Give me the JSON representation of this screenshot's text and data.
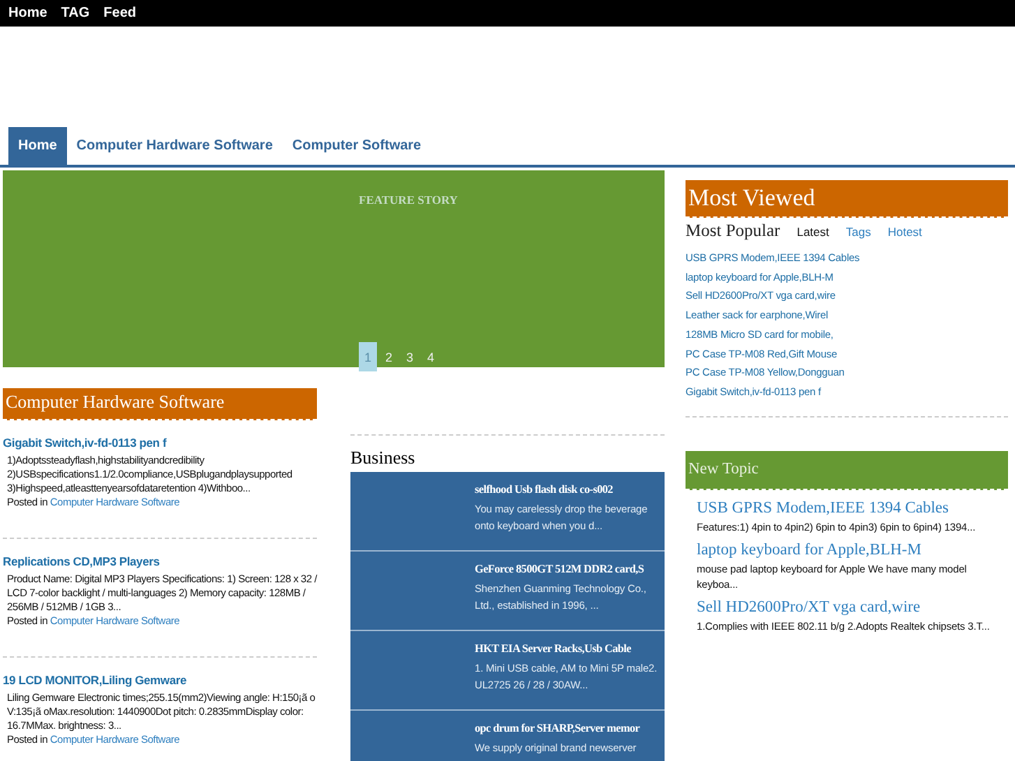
{
  "top_nav": [
    "Home",
    "TAG",
    "Feed"
  ],
  "main_nav": [
    {
      "label": "Home",
      "selected": true
    },
    {
      "label": "Computer Hardware Software",
      "selected": false
    },
    {
      "label": "Computer Software",
      "selected": false
    }
  ],
  "feature": {
    "label": "FEATURE STORY",
    "pages": [
      {
        "label": "1",
        "selected": true
      },
      {
        "label": "2",
        "selected": false
      },
      {
        "label": "3",
        "selected": false
      },
      {
        "label": "4",
        "selected": false
      }
    ]
  },
  "category": {
    "title": "Computer Hardware Software",
    "posts": [
      {
        "title": "Gigabit Switch,iv-fd-0113 pen f",
        "excerpt": "1)Adoptssteadyflash,highstabilityandcredibility 2)USBspecifications1.1/2.0compliance,USBplugandplaysupported 3)Highspeed,atleasttenyearsofdataretention 4)Withboo...",
        "posted": "Posted in",
        "category": "Computer Hardware Software"
      },
      {
        "title": "Replications CD,MP3 Players",
        "excerpt": "Product Name: Digital MP3 Players Specifications: 1) Screen: 128 x 32 / LCD 7-color backlight / multi-languages 2) Memory capacity: 128MB / 256MB / 512MB / 1GB 3...",
        "posted": "Posted in",
        "category": "Computer Hardware Software"
      },
      {
        "title": "19  LCD MONITOR,Liling Gemware",
        "excerpt": "Liling Gemware Electronic times;255.15(mm2)Viewing angle: H:150¡ã o V:135¡ã oMax.resolution: 1440900Dot pitch: 0.2835mmDisplay color: 16.7MMax. brightness: 3...",
        "posted": "Posted in",
        "category": "Computer Hardware Software"
      }
    ]
  },
  "business": {
    "title": "Business",
    "items": [
      {
        "title": "selfhood Usb flash disk co-s002",
        "excerpt": "You may carelessly drop the beverage onto keyboard when you d..."
      },
      {
        "title": "GeForce 8500GT 512M DDR2 card,S",
        "excerpt": "Shenzhen Guanming Technology Co., Ltd., established in 1996, ..."
      },
      {
        "title": "HKT EIA Server Racks,Usb Cable",
        "excerpt": "1. Mini USB cable, AM to Mini 5P male2. UL2725 26 / 28 / 30AW..."
      },
      {
        "title": "opc drum for SHARP,Server memor",
        "excerpt": "We supply original brand newserver"
      }
    ]
  },
  "most_viewed": {
    "title": "Most Viewed",
    "heading": "Most Popular",
    "tabs": [
      {
        "label": "Latest",
        "selected": true
      },
      {
        "label": "Tags",
        "selected": false
      },
      {
        "label": "Hotest",
        "selected": false
      }
    ],
    "links": [
      "USB GPRS Modem,IEEE 1394 Cables",
      "laptop keyboard for Apple,BLH-M",
      "Sell HD2600Pro/XT vga card,wire",
      "Leather sack for earphone,Wirel",
      "128MB Micro SD card for mobile,",
      "PC Case TP-M08 Red,Gift Mouse",
      "PC Case TP-M08 Yellow,Dongguan",
      "Gigabit Switch,iv-fd-0113 pen f"
    ]
  },
  "new_topic": {
    "title": "New Topic",
    "items": [
      {
        "title": "USB GPRS Modem,IEEE 1394 Cables",
        "excerpt": "Features:1) 4pin to 4pin2) 6pin to 4pin3) 6pin to 6pin4) 1394..."
      },
      {
        "title": "laptop keyboard for Apple,BLH-M",
        "excerpt": "mouse pad laptop keyboard for Apple We have many model keyboa..."
      },
      {
        "title": "Sell HD2600Pro/XT vga card,wire",
        "excerpt": "1.Complies with IEEE 802.11 b/g 2.Adopts Realtek chipsets 3.T..."
      }
    ]
  }
}
